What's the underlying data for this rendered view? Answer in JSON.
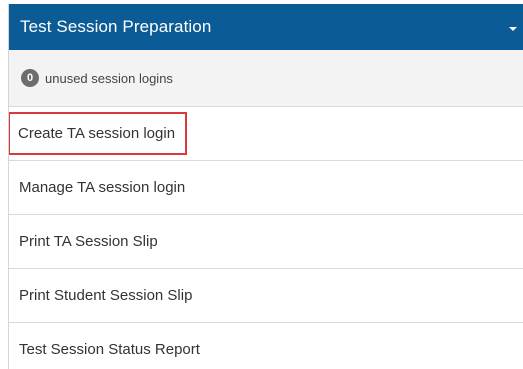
{
  "panel": {
    "title": "Test Session Preparation",
    "toggle_icon": "caret-down-icon",
    "header_color": "#0b5b96"
  },
  "info": {
    "unused_count": "0",
    "unused_label": "unused session logins"
  },
  "menu": {
    "items": [
      {
        "label": "Create TA session login",
        "highlighted": true
      },
      {
        "label": "Manage TA session login",
        "highlighted": false
      },
      {
        "label": "Print TA Session Slip",
        "highlighted": false
      },
      {
        "label": "Print Student Session Slip",
        "highlighted": false
      },
      {
        "label": "Test Session Status Report",
        "highlighted": false
      }
    ],
    "highlight_color": "#d9383c"
  }
}
